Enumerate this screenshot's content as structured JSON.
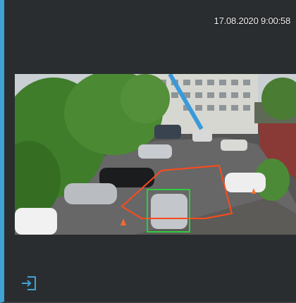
{
  "camera": {
    "timestamp": "17.08.2020 9:00:58"
  },
  "colors": {
    "accent": "#3fa3d6",
    "zone_outline": "#ff4a1c",
    "detection_box": "#2ecc40"
  },
  "controls": {
    "exit_icon": "exit-icon"
  }
}
